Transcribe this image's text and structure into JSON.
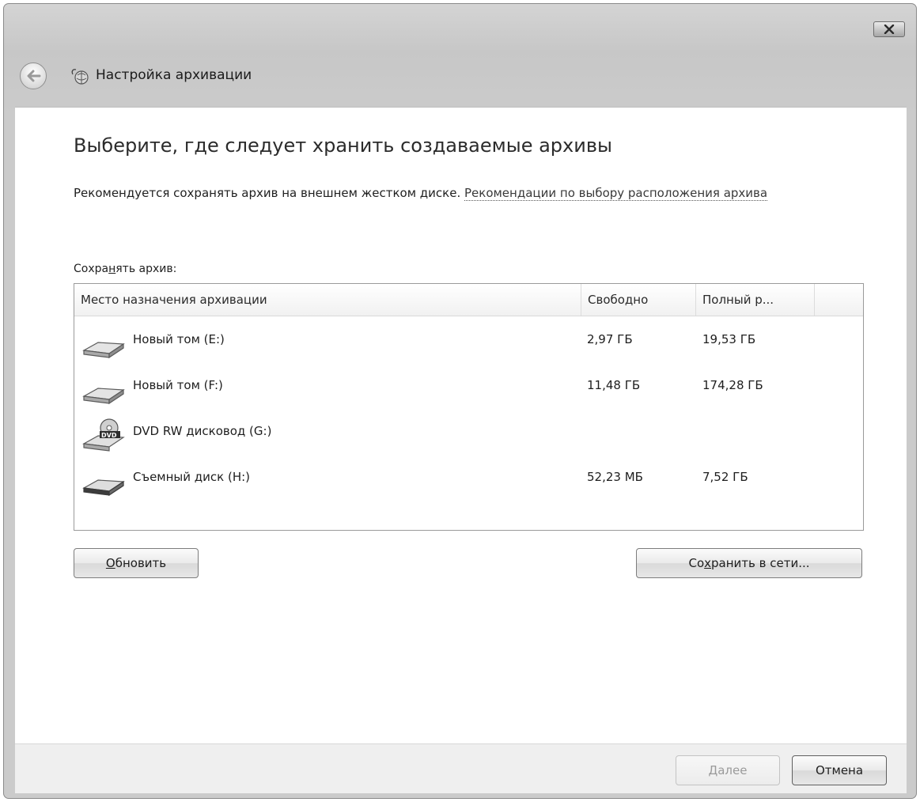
{
  "window": {
    "title": "Настройка архивации",
    "close_label": "X"
  },
  "page": {
    "heading": "Выберите, где следует хранить создаваемые архивы",
    "description_text": "Рекомендуется сохранять архив на внешнем жестком диске. ",
    "description_link": "Рекомендации по выбору расположения архива",
    "list_label_pre": "Сохра",
    "list_label_accel": "н",
    "list_label_post": "ять архив:"
  },
  "table": {
    "columns": [
      "Место назначения архивации",
      "Свободно",
      "Полный р..."
    ],
    "rows": [
      {
        "name": "Новый том (E:)",
        "free": "2,97 ГБ",
        "total": "19,53 ГБ",
        "icon": "hard-drive-icon"
      },
      {
        "name": "Новый том (F:)",
        "free": "11,48 ГБ",
        "total": "174,28 ГБ",
        "icon": "hard-drive-icon"
      },
      {
        "name": "DVD RW дисковод (G:)",
        "free": "",
        "total": "",
        "icon": "dvd-drive-icon"
      },
      {
        "name": "Съемный диск (H:)",
        "free": "52,23 МБ",
        "total": "7,52 ГБ",
        "icon": "removable-drive-icon"
      }
    ]
  },
  "buttons": {
    "refresh_accel": "О",
    "refresh_rest": "бновить",
    "network_pre": "Со",
    "network_accel": "х",
    "network_post": "ранить в сети...",
    "next_accel": "Д",
    "next_rest": "алее",
    "cancel": "Отмена"
  }
}
